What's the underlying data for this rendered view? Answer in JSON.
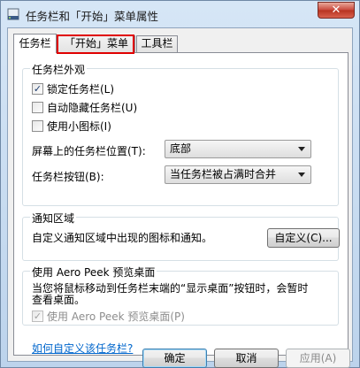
{
  "window": {
    "title": "任务栏和「开始」菜单属性",
    "close_glyph": "✕"
  },
  "tabs": [
    {
      "label": "任务栏",
      "active": true
    },
    {
      "label": "「开始」菜单",
      "active": false,
      "highlighted": true
    },
    {
      "label": "工具栏",
      "active": false
    }
  ],
  "appearance": {
    "title": "任务栏外观",
    "lock_taskbar": {
      "label": "锁定任务栏(L)",
      "checked": true
    },
    "auto_hide": {
      "label": "自动隐藏任务栏(U)",
      "checked": false
    },
    "small_icons": {
      "label": "使用小图标(I)",
      "checked": false
    },
    "location_label": "屏幕上的任务栏位置(T):",
    "location_value": "底部",
    "buttons_label": "任务栏按钮(B):",
    "buttons_value": "当任务栏被占满时合并"
  },
  "notification": {
    "title": "通知区域",
    "description": "自定义通知区域中出现的图标和通知。",
    "customize_button": "自定义(C)..."
  },
  "aero_peek": {
    "title": "使用 Aero Peek 预览桌面",
    "description_line1": "当您将鼠标移动到任务栏末端的“显示桌面”按钮时，会暂时",
    "description_line2": "查看桌面。",
    "checkbox": {
      "label": "使用 Aero Peek 预览桌面(P)",
      "checked": true,
      "enabled": false
    }
  },
  "help_link": "如何自定义该任务栏?",
  "footer": {
    "ok": "确定",
    "cancel": "取消",
    "apply": "应用(A)"
  },
  "colors": {
    "highlight_box": "#e00000",
    "link": "#0066cc"
  }
}
